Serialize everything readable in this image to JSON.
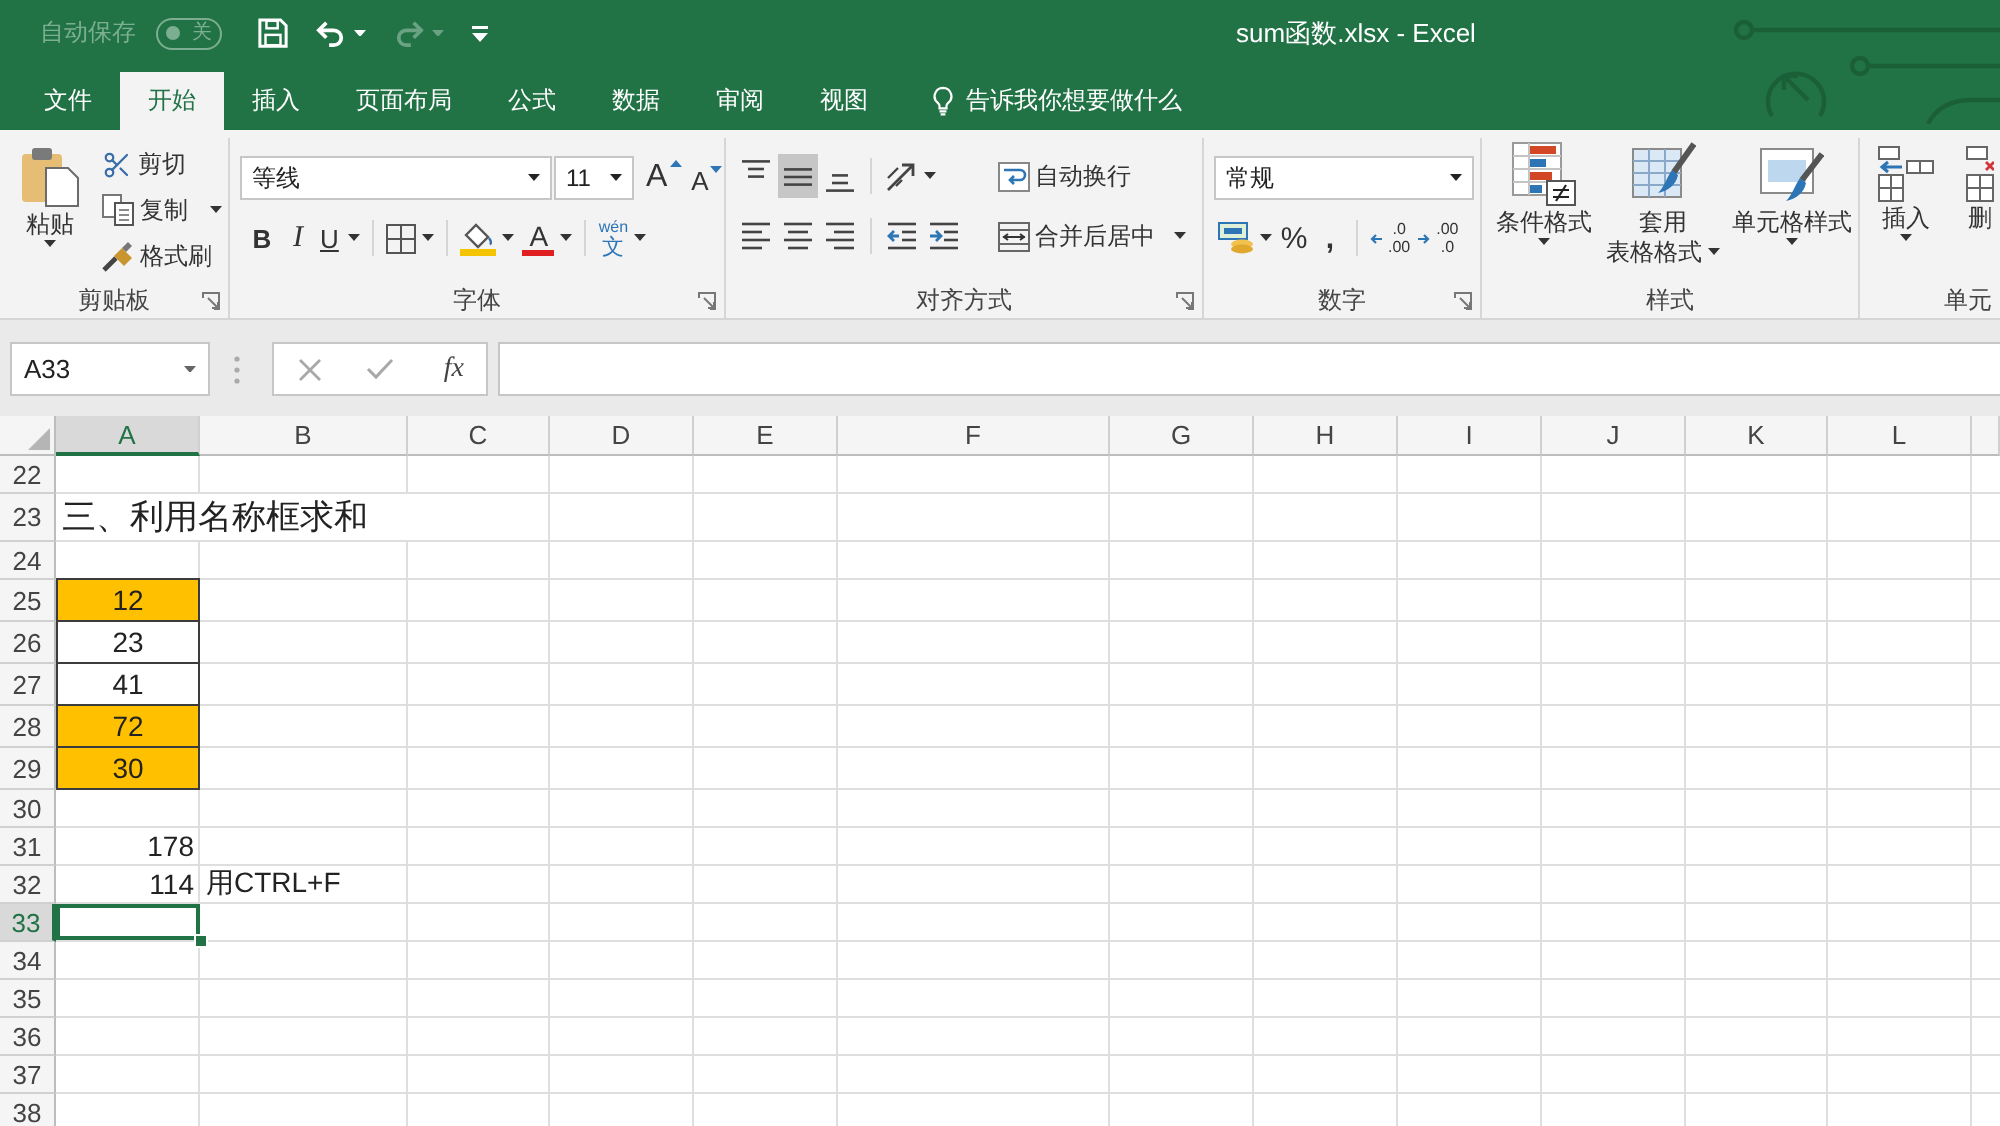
{
  "title_bar": {
    "autosave": {
      "label": "自动保存",
      "state": "关",
      "on": false,
      "disabled": true
    },
    "quick_access": [
      {
        "kind": "save",
        "disabled": false
      },
      {
        "kind": "undo",
        "disabled": false
      },
      {
        "kind": "redo",
        "disabled": true
      },
      {
        "kind": "customize",
        "disabled": false
      }
    ],
    "title": "sum函数.xlsx - Excel"
  },
  "tabs": [
    {
      "label": "文件",
      "selected": false
    },
    {
      "label": "开始",
      "selected": true
    },
    {
      "label": "插入",
      "selected": false
    },
    {
      "label": "页面布局",
      "selected": false
    },
    {
      "label": "公式",
      "selected": false
    },
    {
      "label": "数据",
      "selected": false
    },
    {
      "label": "审阅",
      "selected": false
    },
    {
      "label": "视图",
      "selected": false
    }
  ],
  "tell_me": {
    "label": "告诉我你想要做什么"
  },
  "ribbon": {
    "clipboard": {
      "label": "剪贴板",
      "launcher": true,
      "paste": "粘贴",
      "cut": "剪切",
      "copy": "复制",
      "format_painter": "格式刷"
    },
    "font": {
      "label": "字体",
      "launcher": true,
      "font_name": "等线",
      "font_size": "11",
      "grow_font": "A",
      "shrink_font": "A",
      "bold": "B",
      "italic": "I",
      "underline": "U",
      "font_color": "A",
      "phonetic": [
        "wén",
        "文"
      ]
    },
    "alignment": {
      "label": "对齐方式",
      "launcher": true,
      "vertical_align": [
        {
          "selected": false
        },
        {
          "selected": true
        },
        {
          "selected": false
        }
      ],
      "horizontal_align": [
        {
          "selected": false
        },
        {
          "selected": false
        },
        {
          "selected": false
        }
      ],
      "wrap_text": "自动换行",
      "merge_center": "合并后居中"
    },
    "number": {
      "label": "数字",
      "launcher": true,
      "format": "常规",
      "percent": "%",
      "comma": ",",
      "increase_decimal": [
        ".0",
        ".00"
      ],
      "decrease_decimal": [
        ".00",
        ".0"
      ]
    },
    "styles": {
      "label": "样式",
      "launcher": false,
      "conditional_formatting": "条件格式",
      "format_as_table": [
        "套用",
        "表格格式"
      ],
      "cell_styles": "单元格样式"
    },
    "cells": {
      "label": "单元",
      "launcher": false,
      "insert": "插入",
      "delete": "删"
    }
  },
  "formula_bar": {
    "name_box": "A33",
    "insert_function": "fx"
  },
  "sheet": {
    "columns": [
      {
        "label": "A",
        "selected": true
      },
      {
        "label": "B",
        "selected": false
      },
      {
        "label": "C",
        "selected": false
      },
      {
        "label": "D",
        "selected": false
      },
      {
        "label": "E",
        "selected": false
      },
      {
        "label": "F",
        "selected": false
      },
      {
        "label": "G",
        "selected": false
      },
      {
        "label": "H",
        "selected": false
      },
      {
        "label": "I",
        "selected": false
      },
      {
        "label": "J",
        "selected": false
      },
      {
        "label": "K",
        "selected": false
      },
      {
        "label": "L",
        "selected": false
      }
    ],
    "rows": [
      {
        "label": "22",
        "selected": false
      },
      {
        "label": "23",
        "selected": false,
        "cells": [
          {
            "kind": "title",
            "value": "三、利用名称框求和",
            "selected": false
          }
        ]
      },
      {
        "label": "24",
        "selected": false
      },
      {
        "label": "25",
        "selected": false,
        "cells": [
          {
            "kind": "boxed",
            "value": "12",
            "color": "#ffc000",
            "selected": false
          }
        ]
      },
      {
        "label": "26",
        "selected": false,
        "cells": [
          {
            "kind": "boxed",
            "value": "23",
            "color": "#ffffff",
            "selected": false
          }
        ]
      },
      {
        "label": "27",
        "selected": false,
        "cells": [
          {
            "kind": "boxed",
            "value": "41",
            "color": "#ffffff",
            "selected": false
          }
        ]
      },
      {
        "label": "28",
        "selected": false,
        "cells": [
          {
            "kind": "boxed",
            "value": "72",
            "color": "#ffc000",
            "selected": false
          }
        ]
      },
      {
        "label": "29",
        "selected": false,
        "cells": [
          {
            "kind": "boxed",
            "value": "30",
            "color": "#ffc000",
            "selected": false
          }
        ]
      },
      {
        "label": "30",
        "selected": false
      },
      {
        "label": "31",
        "selected": false,
        "cells": [
          {
            "kind": "number",
            "value": "178",
            "selected": false
          }
        ]
      },
      {
        "label": "32",
        "selected": false,
        "cells": [
          {
            "kind": "number",
            "value": "114",
            "selected": false
          },
          {
            "kind": "text",
            "value": "用CTRL+F",
            "selected": false
          }
        ]
      },
      {
        "label": "33",
        "selected": true,
        "cells": [
          {
            "kind": "empty",
            "selected": true
          }
        ]
      },
      {
        "label": "34",
        "selected": false
      },
      {
        "label": "35",
        "selected": false
      },
      {
        "label": "36",
        "selected": false
      },
      {
        "label": "37",
        "selected": false
      },
      {
        "label": "38",
        "selected": false
      }
    ]
  }
}
